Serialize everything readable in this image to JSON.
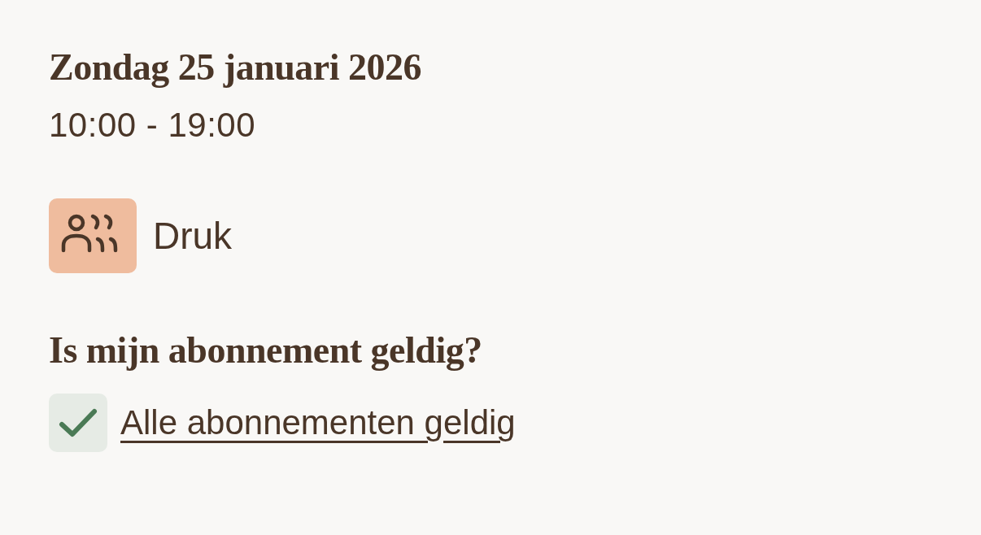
{
  "day": {
    "title": "Zondag 25 januari 2026",
    "hours": "10:00 - 19:00"
  },
  "crowd": {
    "label": "Druk"
  },
  "validity": {
    "question": "Is mijn abonnement geldig?",
    "items": [
      {
        "label": "Alle abonnementen geldig",
        "checked": true
      }
    ]
  }
}
